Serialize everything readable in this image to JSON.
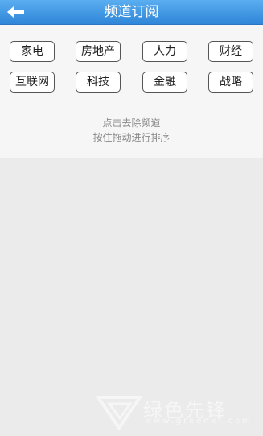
{
  "header": {
    "title": "频道订阅",
    "back_icon": "back-arrow-icon",
    "background": "#3b95e2"
  },
  "channels": [
    {
      "label": "家电"
    },
    {
      "label": "房地产"
    },
    {
      "label": "人力"
    },
    {
      "label": "财经"
    },
    {
      "label": "互联网"
    },
    {
      "label": "科技"
    },
    {
      "label": "金融"
    },
    {
      "label": "战略"
    }
  ],
  "hints": {
    "line1": "点击去除频道",
    "line2": "按住拖动进行排序"
  },
  "watermark": {
    "brand": "绿色先锋",
    "url": "www.greenxf.com"
  }
}
